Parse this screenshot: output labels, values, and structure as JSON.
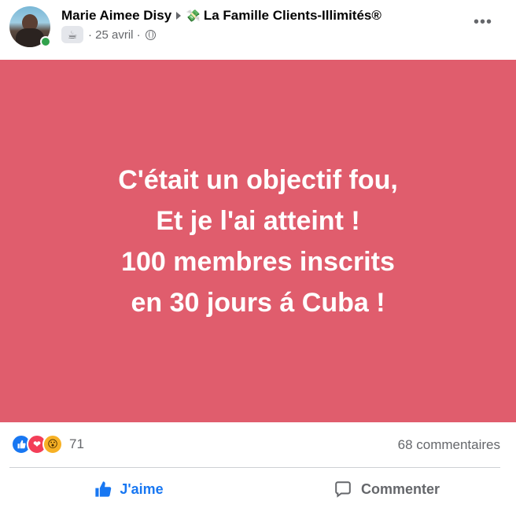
{
  "post": {
    "author": "Marie Aimee Disy",
    "group": "La Famille Clients-Illimités®",
    "date": "· 25 avril ·",
    "text_lines": [
      "C'était un objectif fou,",
      "Et je l'ai atteint !",
      "100 membres inscrits",
      "en 30 jours á Cuba !"
    ],
    "background_color": "#e05d6d"
  },
  "icons": {
    "group_prefix": "money-with-wings-icon",
    "badge": "coffee-cup-icon",
    "privacy": "globe-icon",
    "more": "more-options-icon"
  },
  "reactions": {
    "types": [
      "like",
      "love",
      "wow"
    ],
    "count": "71",
    "comments": "68 commentaires"
  },
  "actions": {
    "like_label": "J'aime",
    "comment_label": "Commenter"
  },
  "colors": {
    "facebook_blue": "#1877f2",
    "secondary_text": "#65676b",
    "online": "#31a24c"
  }
}
